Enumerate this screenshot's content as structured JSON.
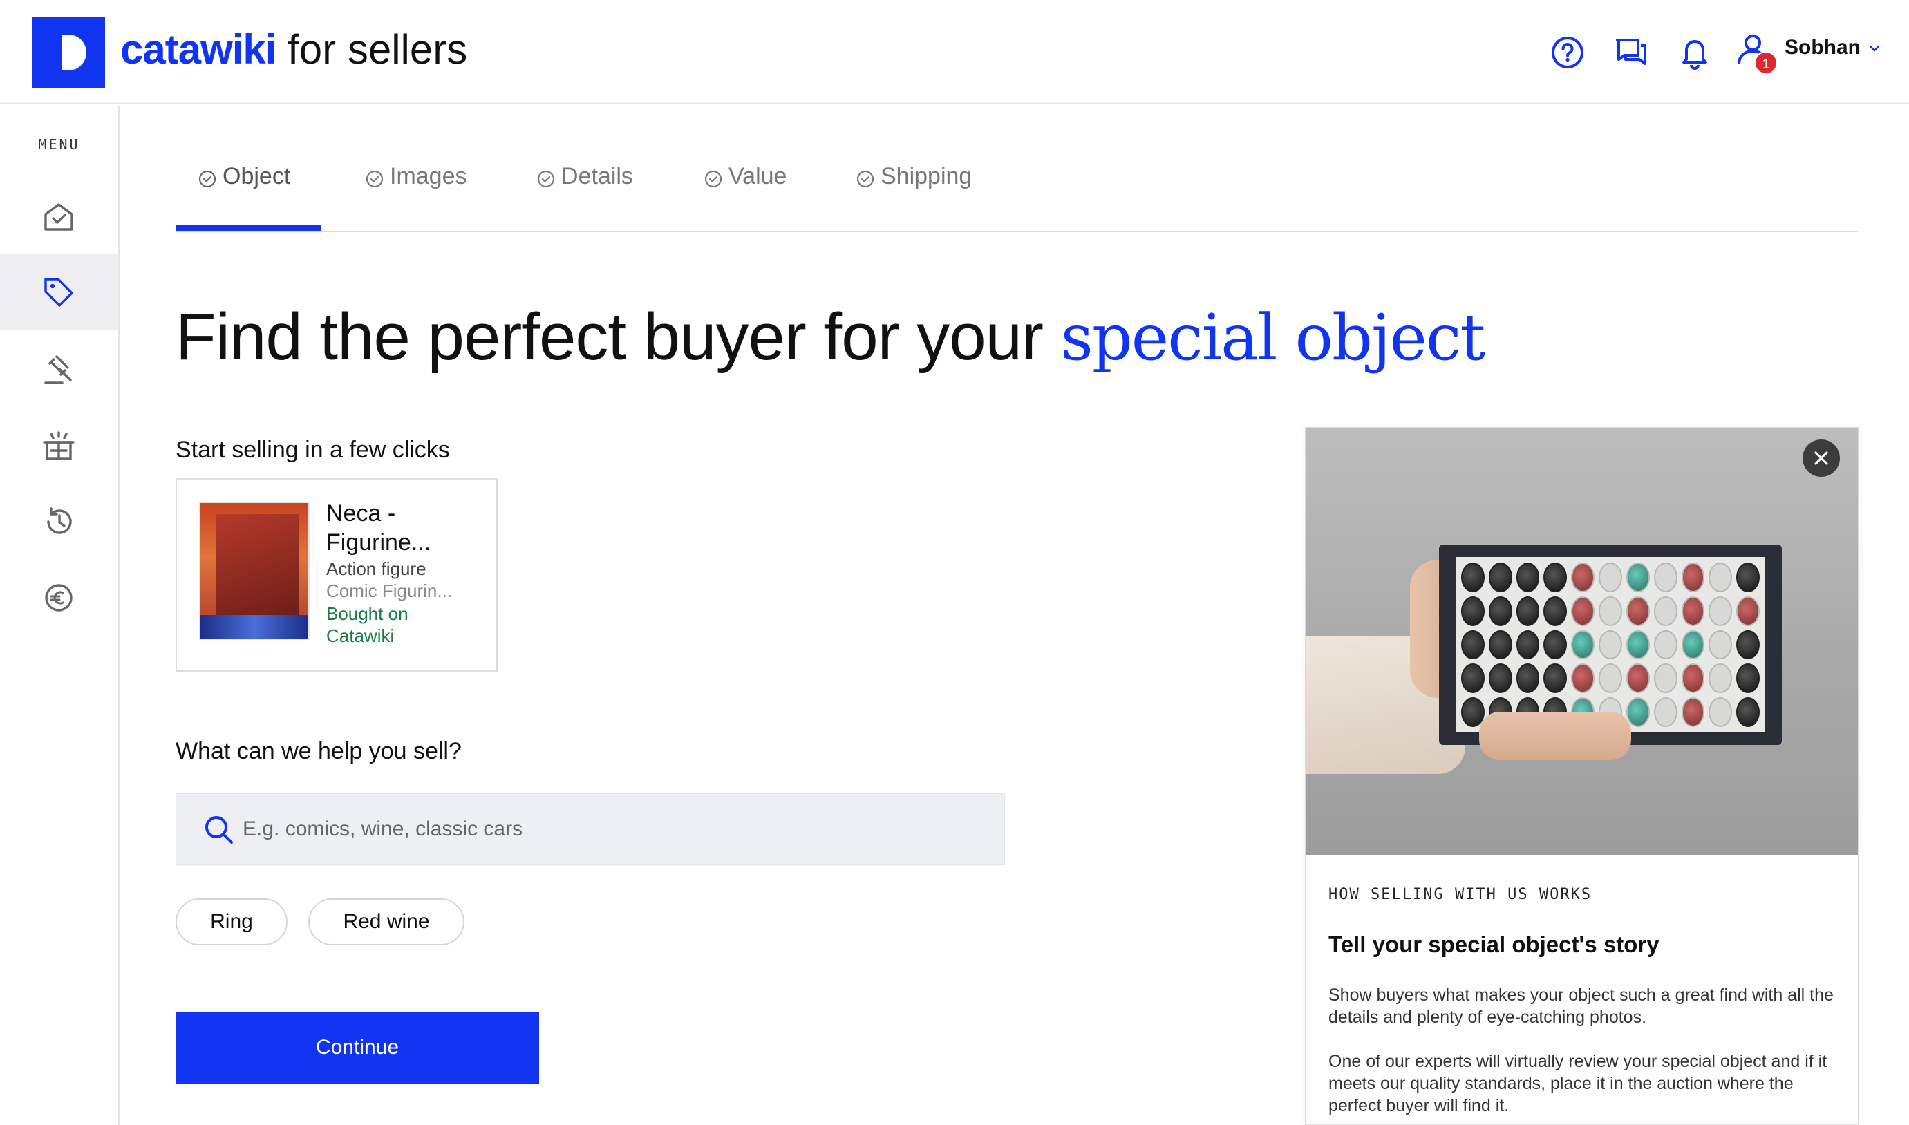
{
  "brand": {
    "name": "catawiki",
    "suffix": "for sellers"
  },
  "header": {
    "user_name": "Sobhan",
    "notification_count": "1",
    "icons": [
      "help-icon",
      "messages-icon",
      "bell-icon",
      "user-icon",
      "chevron-down-icon"
    ]
  },
  "sidebar": {
    "menu_label": "MENU",
    "items": [
      {
        "name": "home",
        "icon": "home-check-icon",
        "active": false
      },
      {
        "name": "sell",
        "icon": "tag-icon",
        "active": true
      },
      {
        "name": "auctions",
        "icon": "gavel-icon",
        "active": false
      },
      {
        "name": "shipping",
        "icon": "gift-box-icon",
        "active": false
      },
      {
        "name": "history",
        "icon": "history-icon",
        "active": false
      },
      {
        "name": "payments",
        "icon": "euro-icon",
        "active": false
      }
    ]
  },
  "tabs": [
    {
      "label": "Object",
      "active": true
    },
    {
      "label": "Images",
      "active": false
    },
    {
      "label": "Details",
      "active": false
    },
    {
      "label": "Value",
      "active": false
    },
    {
      "label": "Shipping",
      "active": false
    }
  ],
  "hero": {
    "text": "Find the perfect buyer for your ",
    "accent": "special object"
  },
  "recent": {
    "heading": "Start selling in a few clicks",
    "card": {
      "title": "Neca - Figurine...",
      "category": "Action figure",
      "subcategory": "Comic Figurin...",
      "source": "Bought on Catawiki"
    }
  },
  "search": {
    "heading": "What can we help you sell?",
    "placeholder": "E.g. comics, wine, classic cars",
    "value": "",
    "chips": [
      "Ring",
      "Red wine"
    ]
  },
  "continue_label": "Continue",
  "info_panel": {
    "kicker": "HOW SELLING WITH US WORKS",
    "title": "Tell your special object's story",
    "paragraphs": [
      "Show buyers what makes your object such a great find with all the details and plenty of eye-catching photos.",
      "One of our experts will virtually review your special object and if it meets our quality standards, place it in the auction where the perfect buyer will find it."
    ]
  },
  "colors": {
    "brand": "#1034f0",
    "success": "#1d7a47",
    "badge": "#e0262f"
  }
}
